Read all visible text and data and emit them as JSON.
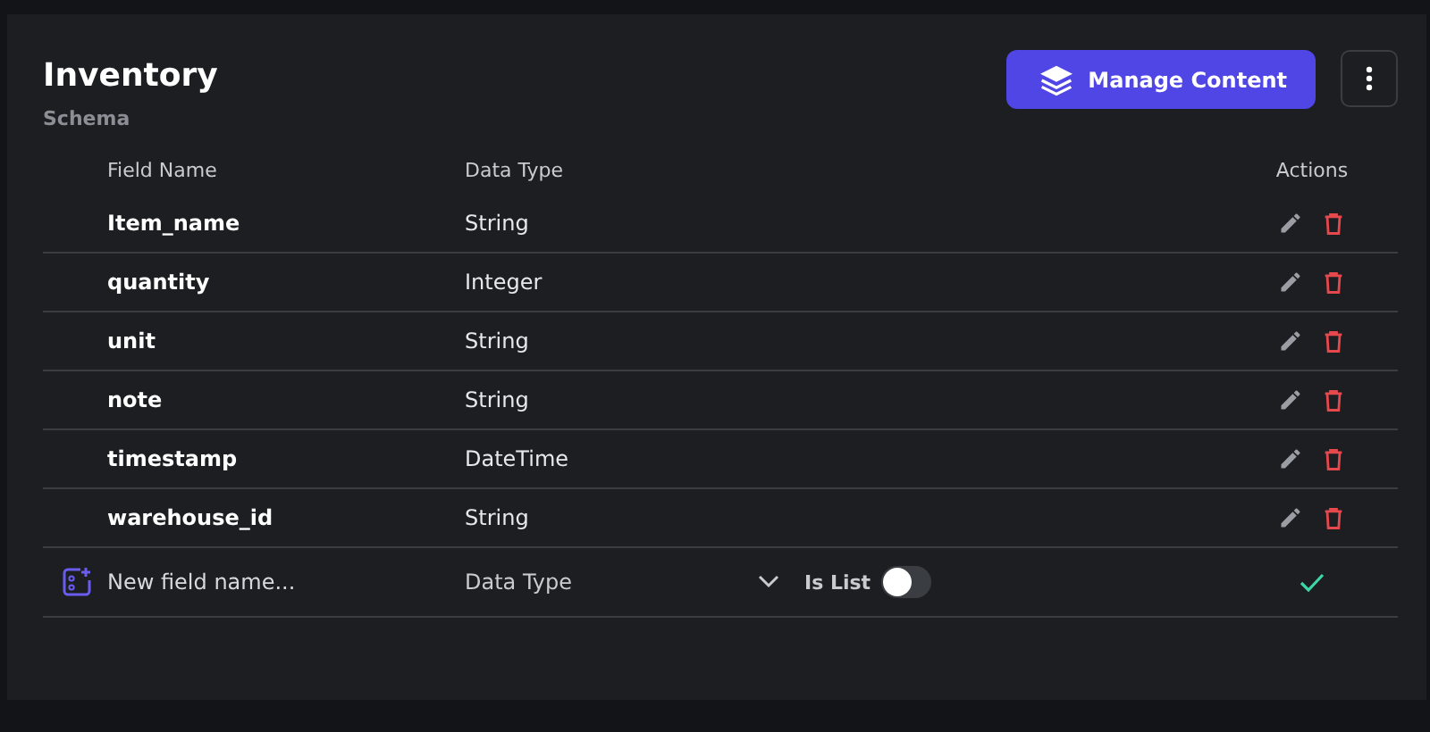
{
  "header": {
    "title": "Inventory",
    "subtitle": "Schema",
    "primary_button": "Manage Content"
  },
  "table": {
    "columns": [
      "Field Name",
      "Data Type",
      "Actions"
    ],
    "rows": [
      {
        "name": "Item_name",
        "type": "String"
      },
      {
        "name": "quantity",
        "type": "Integer"
      },
      {
        "name": "unit",
        "type": "String"
      },
      {
        "name": "note",
        "type": "String"
      },
      {
        "name": "timestamp",
        "type": "DateTime"
      },
      {
        "name": "warehouse_id",
        "type": "String"
      }
    ]
  },
  "new_field": {
    "name_placeholder": "New field name...",
    "type_placeholder": "Data Type",
    "is_list_label": "Is List",
    "is_list": false
  }
}
